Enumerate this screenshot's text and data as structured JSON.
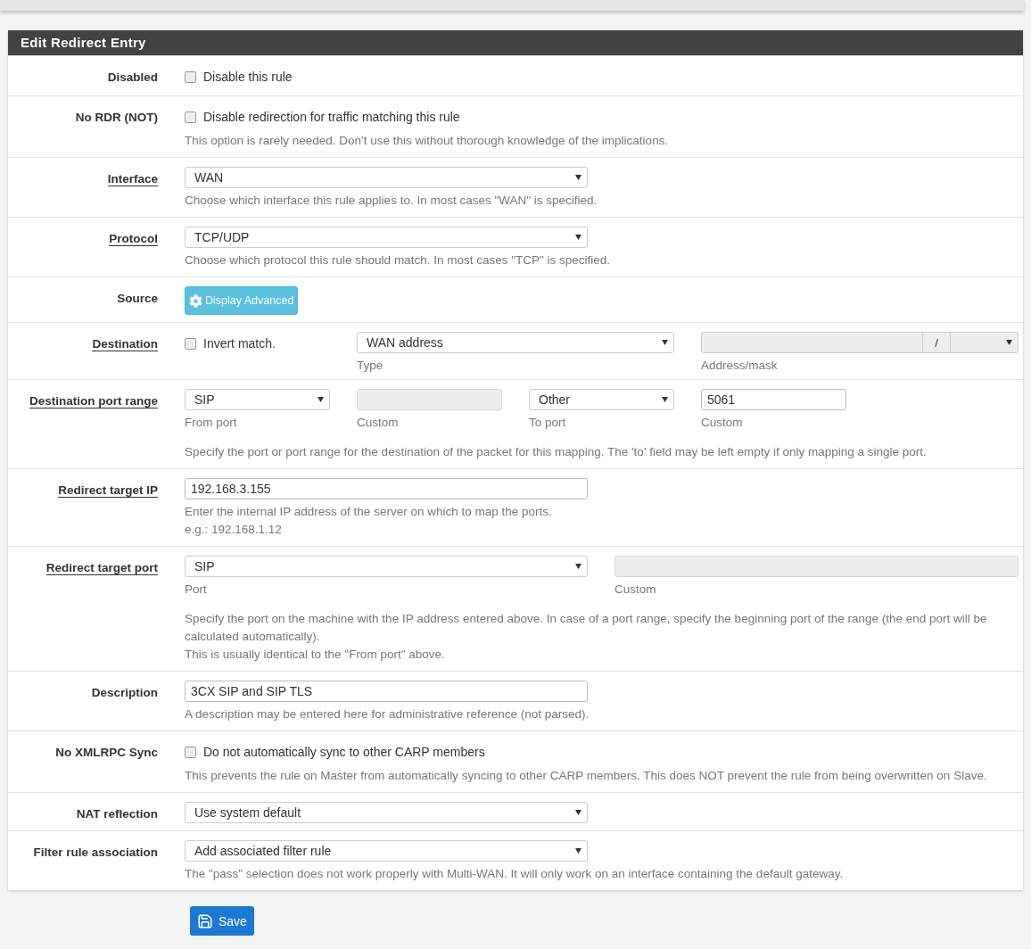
{
  "panel": {
    "title": "Edit Redirect Entry"
  },
  "rows": [
    {
      "kind": "checkbox",
      "label": "Disabled",
      "help_link": false,
      "checkbox": {
        "text": "Disable this rule",
        "checked": false
      }
    },
    {
      "kind": "checkbox",
      "label": "No RDR (NOT)",
      "help_link": false,
      "checkbox": {
        "text": "Disable redirection for traffic matching this rule",
        "checked": false
      },
      "help": [
        "This option is rarely needed. Don't use this without thorough knowledge of the implications."
      ]
    },
    {
      "kind": "select",
      "label": "Interface",
      "help_link": true,
      "value": "WAN",
      "help": [
        "Choose which interface this rule applies to. In most cases \"WAN\" is specified."
      ]
    },
    {
      "kind": "select",
      "label": "Protocol",
      "help_link": true,
      "value": "TCP/UDP",
      "help": [
        "Choose which protocol this rule should match. In most cases \"TCP\" is specified."
      ]
    },
    {
      "kind": "button",
      "label": "Source",
      "help_link": false,
      "button": "Display Advanced"
    },
    {
      "kind": "destination",
      "label": "Destination",
      "help_link": true,
      "checkbox": {
        "text": "Invert match.",
        "checked": false
      },
      "type": {
        "value": "WAN address",
        "caption": "Type"
      },
      "address": {
        "separator": "/",
        "caption": "Address/mask",
        "disabled": true
      }
    },
    {
      "kind": "ports",
      "label": "Destination port range",
      "help_link": true,
      "controls": [
        {
          "kind": "select",
          "value": "SIP",
          "caption": "From port"
        },
        {
          "kind": "input",
          "caption": "Custom",
          "disabled": true
        },
        {
          "kind": "select",
          "value": "Other",
          "caption": "To port"
        },
        {
          "kind": "input",
          "value": "5061",
          "caption": "Custom",
          "disabled": false
        }
      ],
      "help": [
        "Specify the port or port range for the destination of the packet for this mapping. The 'to' field may be left empty if only mapping a single port."
      ]
    },
    {
      "kind": "input",
      "label": "Redirect target IP",
      "help_link": true,
      "value": "192.168.3.155",
      "help": [
        "Enter the internal IP address of the server on which to map the ports.",
        "e.g.: 192.168.1.12"
      ]
    },
    {
      "kind": "ports2",
      "label": "Redirect target port",
      "help_link": true,
      "controls": [
        {
          "kind": "select",
          "value": "SIP",
          "caption": "Port"
        },
        {
          "kind": "input",
          "caption": "Custom",
          "disabled": true
        }
      ],
      "help": [
        "Specify the port on the machine with the IP address entered above. In case of a port range, specify the beginning port of the range (the end port will be calculated automatically).",
        "This is usually identical to the \"From port\" above."
      ]
    },
    {
      "kind": "input",
      "label": "Description",
      "help_link": false,
      "value": "3CX SIP and SIP TLS",
      "help": [
        "A description may be entered here for administrative reference (not parsed)."
      ]
    },
    {
      "kind": "checkbox",
      "label": "No XMLRPC Sync",
      "help_link": false,
      "checkbox": {
        "text": "Do not automatically sync to other CARP members",
        "checked": false
      },
      "help": [
        "This prevents the rule on Master from automatically syncing to other CARP members. This does NOT prevent the rule from being overwritten on Slave."
      ]
    },
    {
      "kind": "select",
      "label": "NAT reflection",
      "help_link": false,
      "value": "Use system default"
    },
    {
      "kind": "select",
      "label": "Filter rule association",
      "help_link": false,
      "value": "Add associated filter rule",
      "help": [
        "The \"pass\" selection does not work properly with Multi-WAN. It will only work on an interface containing the default gateway."
      ]
    }
  ],
  "save_button": "Save"
}
